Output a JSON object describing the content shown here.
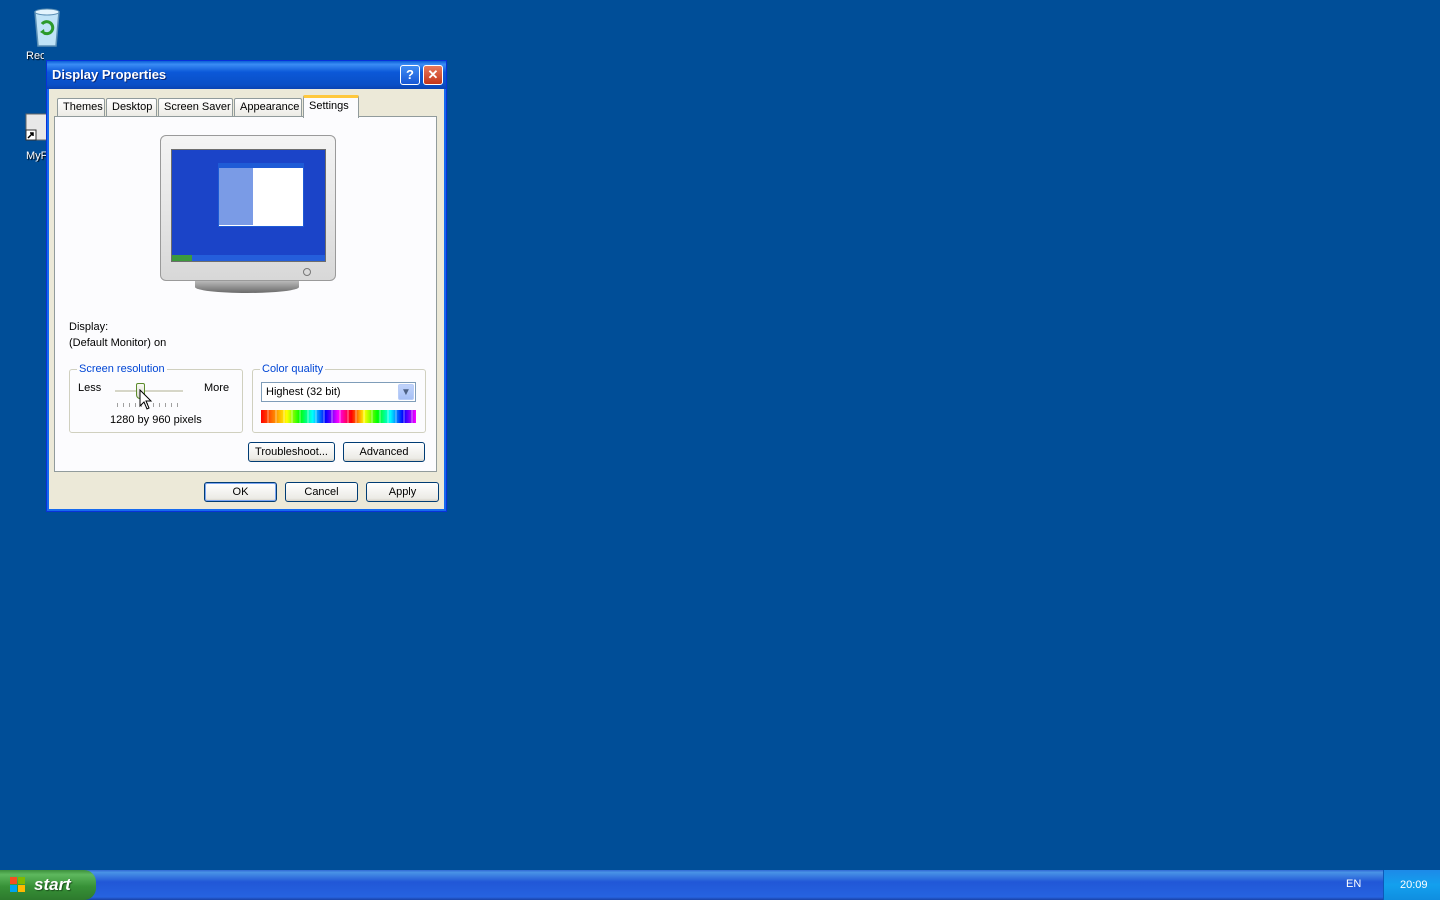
{
  "desktop": {
    "icons": [
      {
        "label": "Recycle Bin"
      },
      {
        "label": "MyF"
      }
    ]
  },
  "dialog": {
    "title": "Display Properties",
    "help_glyph": "?",
    "close_glyph": "✕",
    "tabs": [
      "Themes",
      "Desktop",
      "Screen Saver",
      "Appearance",
      "Settings"
    ],
    "active_tab": "Settings",
    "display_label": "Display:",
    "display_value": "(Default Monitor) on",
    "resolution": {
      "legend": "Screen resolution",
      "less": "Less",
      "more": "More",
      "value": "1280 by 960 pixels",
      "slider_level_fraction": 0.38
    },
    "color_quality": {
      "legend": "Color quality",
      "selected": "Highest (32 bit)"
    },
    "buttons": {
      "troubleshoot": "Troubleshoot...",
      "advanced": "Advanced",
      "ok": "OK",
      "cancel": "Cancel",
      "apply": "Apply"
    }
  },
  "taskbar": {
    "start_label": "start",
    "language": "EN",
    "clock": "20:09"
  },
  "colors": {
    "desktop": "#004e98",
    "titlebar": "#0a4fc6",
    "dialog_bg": "#ece9d8",
    "taskbar": "#2157d7",
    "start_button": "#379137",
    "accent_tab": "#ffc83c"
  }
}
